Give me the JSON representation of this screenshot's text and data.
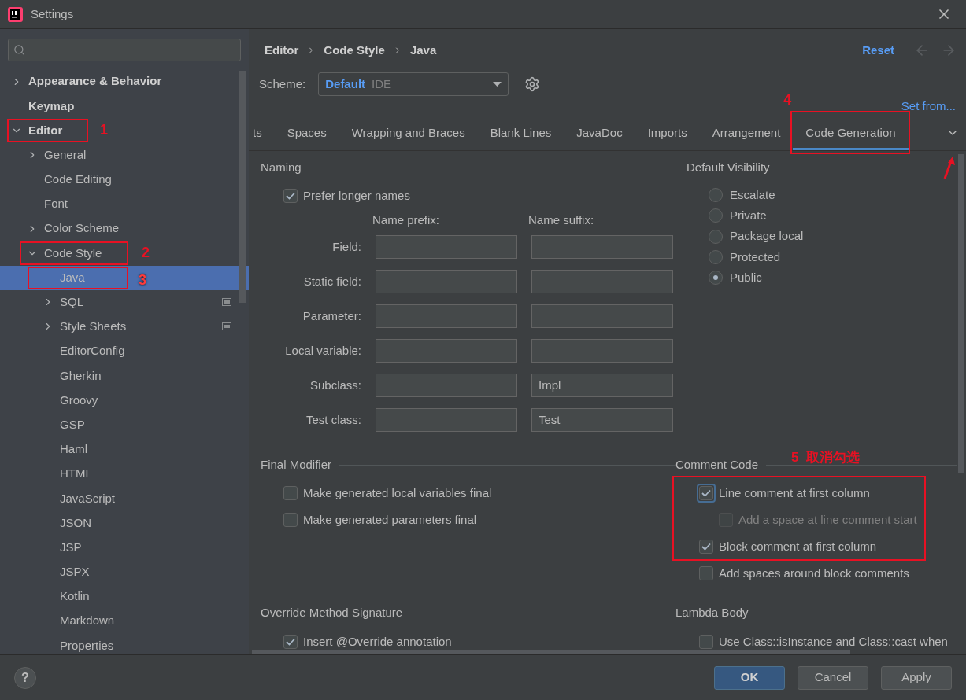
{
  "window": {
    "title": "Settings"
  },
  "sidebar": {
    "items": [
      {
        "label": "Appearance & Behavior",
        "expanded": false,
        "selected": false
      },
      {
        "label": "Keymap",
        "selected": false
      },
      {
        "label": "Editor",
        "expanded": true,
        "selected": false,
        "annotation": "1",
        "children": [
          {
            "label": "General",
            "expanded": false,
            "selected": false
          },
          {
            "label": "Code Editing",
            "selected": false
          },
          {
            "label": "Font",
            "selected": false
          },
          {
            "label": "Color Scheme",
            "expanded": false,
            "selected": false
          },
          {
            "label": "Code Style",
            "expanded": true,
            "selected": false,
            "annotation": "2",
            "children": [
              {
                "label": "Java",
                "selected": true,
                "annotation": "3"
              },
              {
                "label": "SQL",
                "expanded": false,
                "selected": false,
                "project_scope": true
              },
              {
                "label": "Style Sheets",
                "expanded": false,
                "selected": false,
                "project_scope": true
              },
              {
                "label": "EditorConfig",
                "selected": false
              },
              {
                "label": "Gherkin",
                "selected": false
              },
              {
                "label": "Groovy",
                "selected": false
              },
              {
                "label": "GSP",
                "selected": false
              },
              {
                "label": "Haml",
                "selected": false
              },
              {
                "label": "HTML",
                "selected": false
              },
              {
                "label": "JavaScript",
                "selected": false
              },
              {
                "label": "JSON",
                "selected": false
              },
              {
                "label": "JSP",
                "selected": false
              },
              {
                "label": "JSPX",
                "selected": false
              },
              {
                "label": "Kotlin",
                "selected": false
              },
              {
                "label": "Markdown",
                "selected": false
              },
              {
                "label": "Properties",
                "selected": false
              }
            ]
          }
        ]
      }
    ]
  },
  "breadcrumb": [
    "Editor",
    "Code Style",
    "Java"
  ],
  "reset": "Reset",
  "scheme": {
    "label": "Scheme:",
    "value": "Default",
    "suffix": "IDE"
  },
  "set_from": "Set from...",
  "tabs": [
    {
      "label": "ts",
      "selected": false
    },
    {
      "label": "Spaces",
      "selected": false
    },
    {
      "label": "Wrapping and Braces",
      "selected": false
    },
    {
      "label": "Blank Lines",
      "selected": false
    },
    {
      "label": "JavaDoc",
      "selected": false
    },
    {
      "label": "Imports",
      "selected": false
    },
    {
      "label": "Arrangement",
      "selected": false
    },
    {
      "label": "Code Generation",
      "selected": true,
      "annotation": "4"
    }
  ],
  "naming": {
    "title": "Naming",
    "prefer": {
      "label": "Prefer longer names",
      "checked": true
    },
    "prefix_header": "Name prefix:",
    "suffix_header": "Name suffix:",
    "rows": [
      {
        "label": "Field:"
      },
      {
        "label": "Static field:"
      },
      {
        "label": "Parameter:"
      },
      {
        "label": "Local variable:"
      },
      {
        "label": "Subclass:",
        "suffix": "Impl"
      },
      {
        "label": "Test class:",
        "suffix": "Test"
      }
    ]
  },
  "default_visibility": {
    "title": "Default Visibility",
    "options": [
      {
        "label": "Escalate",
        "selected": false
      },
      {
        "label": "Private",
        "selected": false
      },
      {
        "label": "Package local",
        "selected": false
      },
      {
        "label": "Protected",
        "selected": false
      },
      {
        "label": "Public",
        "selected": true
      }
    ]
  },
  "final_modifier": {
    "title": "Final Modifier",
    "options": [
      {
        "label": "Make generated local variables final",
        "checked": false
      },
      {
        "label": "Make generated parameters final",
        "checked": false
      }
    ]
  },
  "comment_code": {
    "title": "Comment Code",
    "annotation": "5  取消勾选",
    "options": [
      {
        "label": "Line comment at first column",
        "checked": true,
        "focused": true,
        "disabled": false,
        "annotated": true,
        "children": [
          {
            "label": "Add a space at line comment start",
            "checked": false,
            "focused": false,
            "disabled": true,
            "annotated": true
          }
        ]
      },
      {
        "label": "Block comment at first column",
        "checked": true,
        "focused": false,
        "disabled": false,
        "annotated": true
      },
      {
        "label": "Add spaces around block comments",
        "checked": false,
        "focused": false,
        "disabled": false,
        "annotated": false
      }
    ]
  },
  "override": {
    "title": "Override Method Signature",
    "options": [
      {
        "label": "Insert @Override annotation",
        "checked": true
      }
    ]
  },
  "lambda": {
    "title": "Lambda Body",
    "options": [
      {
        "label": "Use Class::isInstance and Class::cast when",
        "checked": false
      }
    ]
  },
  "help": "?",
  "buttons": [
    {
      "label": "OK",
      "kind": "primary"
    },
    {
      "label": "Cancel",
      "kind": "normal"
    },
    {
      "label": "Apply",
      "kind": "normal"
    }
  ]
}
